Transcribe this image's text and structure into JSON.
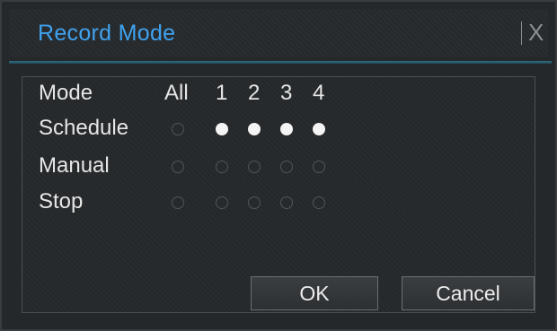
{
  "dialog": {
    "title": "Record Mode",
    "close_label": "X"
  },
  "table": {
    "header_label": "Mode",
    "channels": [
      "All",
      "1",
      "2",
      "3",
      "4"
    ],
    "rows": [
      {
        "label": "Schedule",
        "selected": [
          false,
          true,
          true,
          true,
          true
        ]
      },
      {
        "label": "Manual",
        "selected": [
          false,
          false,
          false,
          false,
          false
        ]
      },
      {
        "label": "Stop",
        "selected": [
          false,
          false,
          false,
          false,
          false
        ]
      }
    ]
  },
  "buttons": {
    "ok_label": "OK",
    "cancel_label": "Cancel"
  },
  "colors": {
    "title": "#3fa2ef",
    "accent_line": "#2f6f84"
  }
}
